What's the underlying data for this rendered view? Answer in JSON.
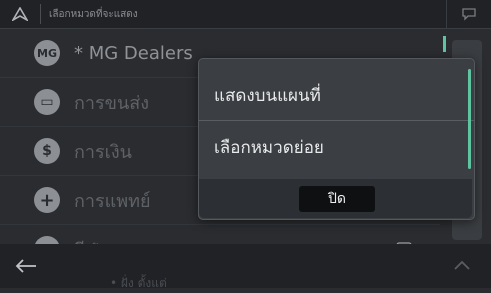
{
  "header": {
    "title": "เลือกหมวดที่จะแสดง",
    "nav_icon": "navigation-arrow-icon",
    "right_icon": "speech-bubble-icon"
  },
  "list": {
    "items": [
      {
        "label": "* MG Dealers",
        "icon": "mg-logo-icon",
        "glyph": "MG"
      },
      {
        "label": "การขนส่ง",
        "icon": "bus-icon",
        "glyph": "▭"
      },
      {
        "label": "การเงิน",
        "icon": "dollar-icon",
        "glyph": "$"
      },
      {
        "label": "การแพทย์",
        "icon": "medical-cross-icon",
        "glyph": "+"
      },
      {
        "label": "กีฬา",
        "icon": "sports-icon",
        "glyph": "◡"
      }
    ]
  },
  "popup": {
    "option1": "แสดงบนแผนที่",
    "option2": "เลือกหมวดย่อย",
    "close_label": "ปิด"
  },
  "bottom": {
    "back_icon": "back-arrow-icon",
    "up_icon": "chevron-up-icon",
    "partial_text": "• ฝั่ง ตั้งแต่"
  },
  "colors": {
    "accent": "#5fc4a0",
    "background": "#2a2c30",
    "popup": "#3b3e42"
  }
}
